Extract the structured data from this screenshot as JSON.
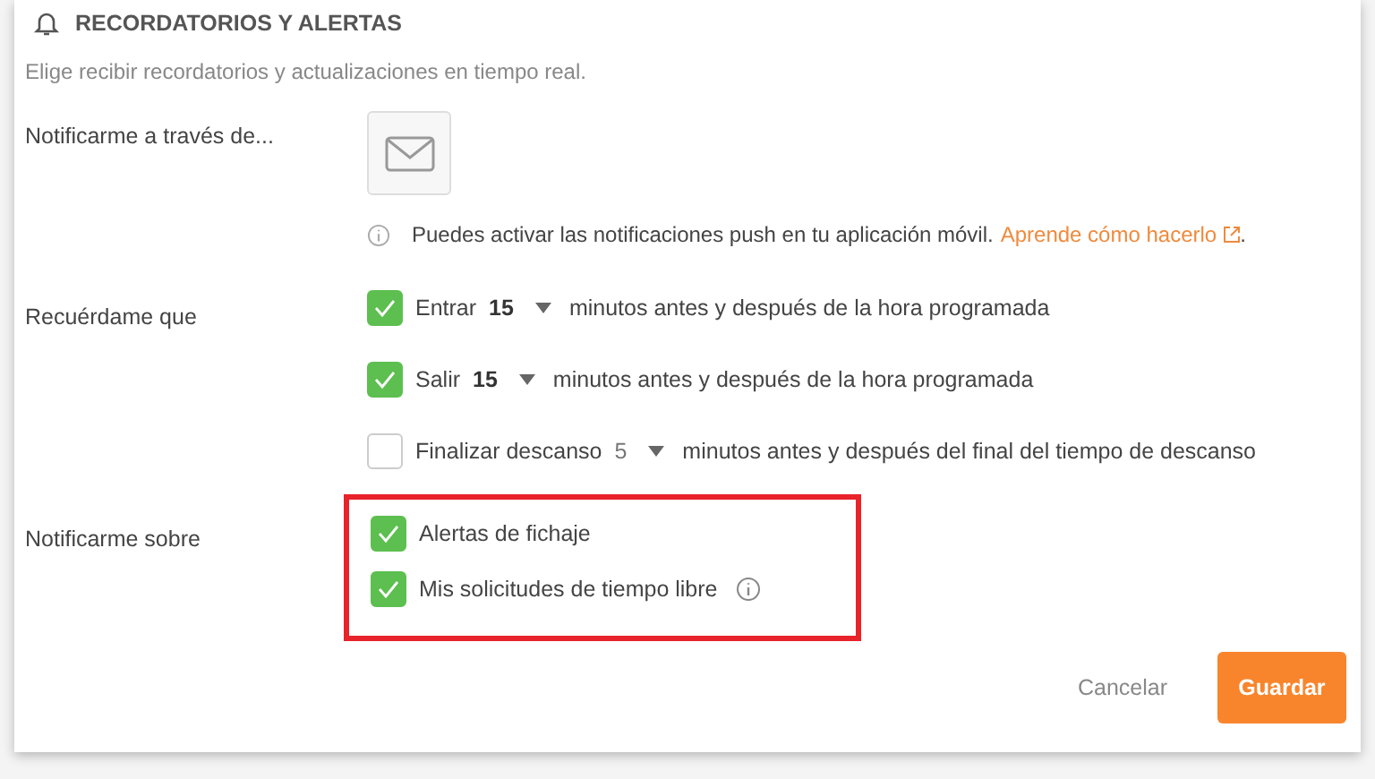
{
  "section": {
    "title": "RECORDATORIOS Y ALERTAS",
    "subtitle": "Elige recibir recordatorios y actualizaciones en tiempo real."
  },
  "notify_via": {
    "label": "Notificarme a través de...",
    "info": "Puedes activar las notificaciones push en tu aplicación móvil.",
    "link": "Aprende cómo hacerlo",
    "after_link": "."
  },
  "reminders": {
    "label": "Recuérdame que",
    "items": [
      {
        "action": "Entrar",
        "value": "15",
        "suffix": "minutos antes y después de la hora programada",
        "checked": true
      },
      {
        "action": "Salir",
        "value": "15",
        "suffix": "minutos antes y después de la hora programada",
        "checked": true
      },
      {
        "action": "Finalizar descanso",
        "value": "5",
        "suffix": "minutos antes y después del final del tiempo de descanso",
        "checked": false
      }
    ]
  },
  "notify_about": {
    "label": "Notificarme sobre",
    "highlighted": true,
    "items": [
      {
        "label": "Alertas de fichaje",
        "checked": true,
        "info": false
      },
      {
        "label": "Mis solicitudes de tiempo libre",
        "checked": true,
        "info": true
      }
    ]
  },
  "buttons": {
    "cancel": "Cancelar",
    "save": "Guardar"
  }
}
